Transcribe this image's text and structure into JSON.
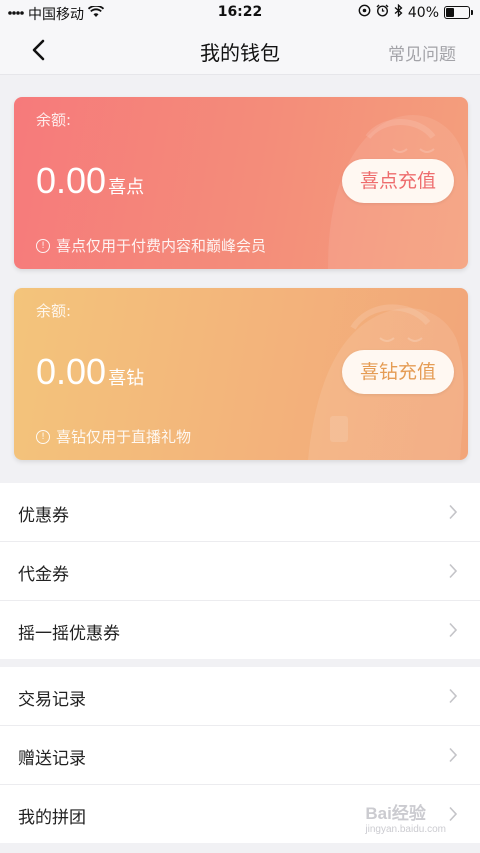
{
  "status_bar": {
    "carrier": "中国移动",
    "time": "16:22",
    "battery_percent": "40%",
    "battery_level": 0.4,
    "icons": [
      "wifi-icon",
      "location-lock-icon",
      "alarm-icon",
      "bluetooth-icon",
      "battery-icon"
    ]
  },
  "nav": {
    "title": "我的钱包",
    "faq_label": "常见问题",
    "back_icon": "chevron-left-icon"
  },
  "cards": {
    "points": {
      "balance_label": "余额:",
      "amount": "0.00",
      "unit": "喜点",
      "recharge_label": "喜点充值",
      "note": "喜点仅用于付费内容和巅峰会员",
      "color_start": "#f67a7b",
      "color_end": "#f4a07c"
    },
    "diamonds": {
      "balance_label": "余额:",
      "amount": "0.00",
      "unit": "喜钻",
      "recharge_label": "喜钻充值",
      "note": "喜钻仅用于直播礼物",
      "color_start": "#f3c47b",
      "color_end": "#f2a57a"
    }
  },
  "menu_group_1": [
    {
      "label": "优惠券"
    },
    {
      "label": "代金券"
    },
    {
      "label": "摇一摇优惠券"
    }
  ],
  "menu_group_2": [
    {
      "label": "交易记录"
    },
    {
      "label": "赠送记录"
    },
    {
      "label": "我的拼团"
    }
  ],
  "watermark": {
    "text": "Bai经验",
    "sub": "jingyan.baidu.com"
  }
}
